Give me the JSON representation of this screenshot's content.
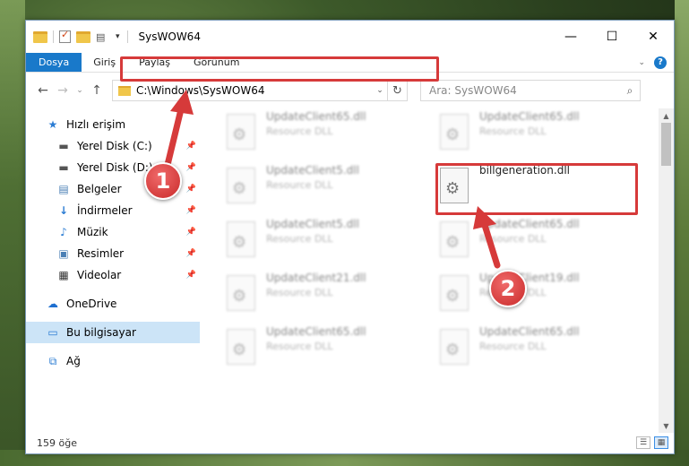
{
  "window": {
    "title": "SysWOW64",
    "controls": {
      "minimize": "—",
      "maximize": "☐",
      "close": "✕"
    }
  },
  "ribbon": {
    "tabs": [
      "Dosya",
      "Giriş",
      "Paylaş",
      "Görünüm"
    ],
    "help": "?"
  },
  "address": {
    "path": "C:\\Windows\\SysWOW64",
    "search_placeholder": "Ara: SysWOW64"
  },
  "sidebar": {
    "quick_access": "Hızlı erişim",
    "items": [
      {
        "label": "Yerel Disk (C:)",
        "icon": "drive-icon",
        "pinned": true
      },
      {
        "label": "Yerel Disk (D:)",
        "icon": "drive-icon",
        "pinned": true
      },
      {
        "label": "Belgeler",
        "icon": "documents-icon",
        "pinned": true
      },
      {
        "label": "İndirmeler",
        "icon": "download-icon",
        "pinned": true
      },
      {
        "label": "Müzik",
        "icon": "music-icon",
        "pinned": true
      },
      {
        "label": "Resimler",
        "icon": "pictures-icon",
        "pinned": true
      },
      {
        "label": "Videolar",
        "icon": "video-icon",
        "pinned": true
      }
    ],
    "onedrive": "OneDrive",
    "this_pc": "Bu bilgisayar",
    "network": "Ağ"
  },
  "files": [
    {
      "name": "UpdateClient65.dll",
      "type": "Resource DLL"
    },
    {
      "name": "UpdateClient65.dll",
      "type": "Resource DLL"
    },
    {
      "name": "UpdateClient5.dll",
      "type": "Resource DLL"
    },
    {
      "name": "billgeneration.dll",
      "type": ""
    },
    {
      "name": "UpdateClient5.dll",
      "type": "Resource DLL"
    },
    {
      "name": "UpdateClient65.dll",
      "type": "Resource DLL"
    },
    {
      "name": "UpdateClient21.dll",
      "type": "Resource DLL"
    },
    {
      "name": "UpdateClient19.dll",
      "type": "Resource DLL"
    },
    {
      "name": "UpdateClient65.dll",
      "type": "Resource DLL"
    },
    {
      "name": "UpdateClient65.dll",
      "type": "Resource DLL"
    }
  ],
  "status": {
    "count": "159 öğe"
  },
  "annotations": {
    "badge1": "1",
    "badge2": "2",
    "highlight_color": "#d63a3a"
  }
}
